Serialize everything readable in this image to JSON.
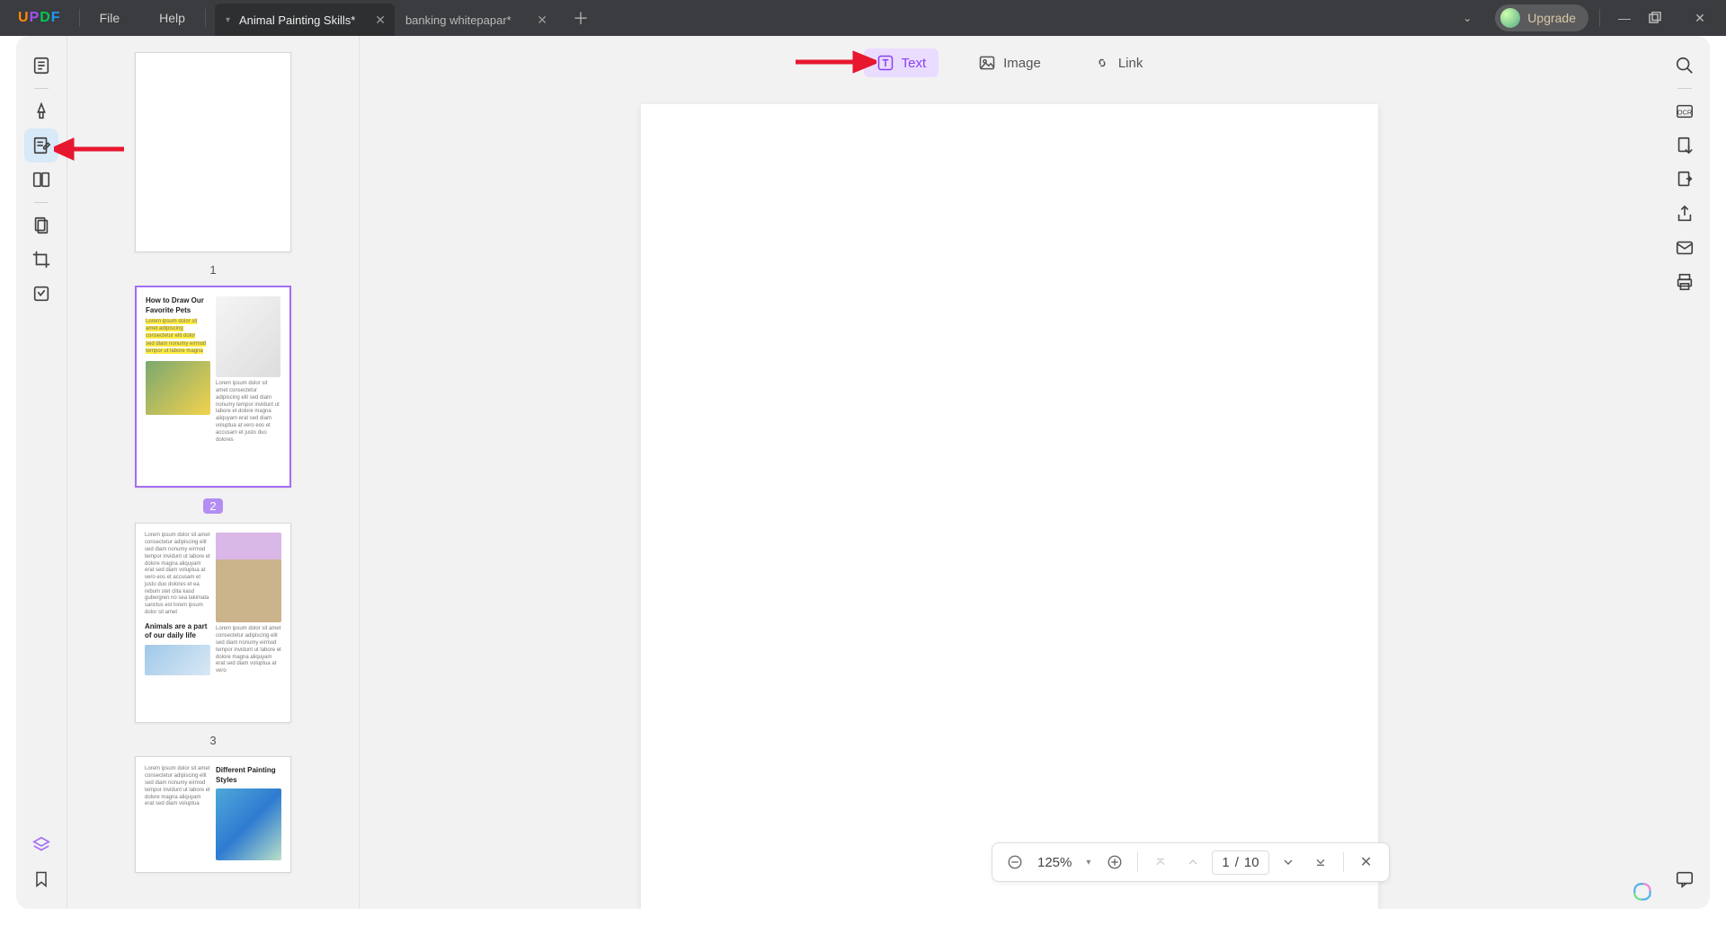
{
  "app": {
    "logo_letters": [
      "U",
      "P",
      "D",
      "F"
    ]
  },
  "menu": {
    "file": "File",
    "help": "Help"
  },
  "tabs": {
    "active": "Animal Painting Skills*",
    "inactive": "banking whitepapar*"
  },
  "titlebar": {
    "upgrade": "Upgrade"
  },
  "edit_tools": {
    "text": "Text",
    "image": "Image",
    "link": "Link"
  },
  "thumbnails": {
    "p1": "1",
    "p2": "2",
    "p3": "3",
    "page2_title": "How to Draw Our Favorite Pets",
    "page3_title": "Animals are a part of our daily life",
    "page4_title": "Different Painting Styles"
  },
  "pagebar": {
    "zoom": "125%",
    "current": "1",
    "sep": "/",
    "total": "10"
  }
}
